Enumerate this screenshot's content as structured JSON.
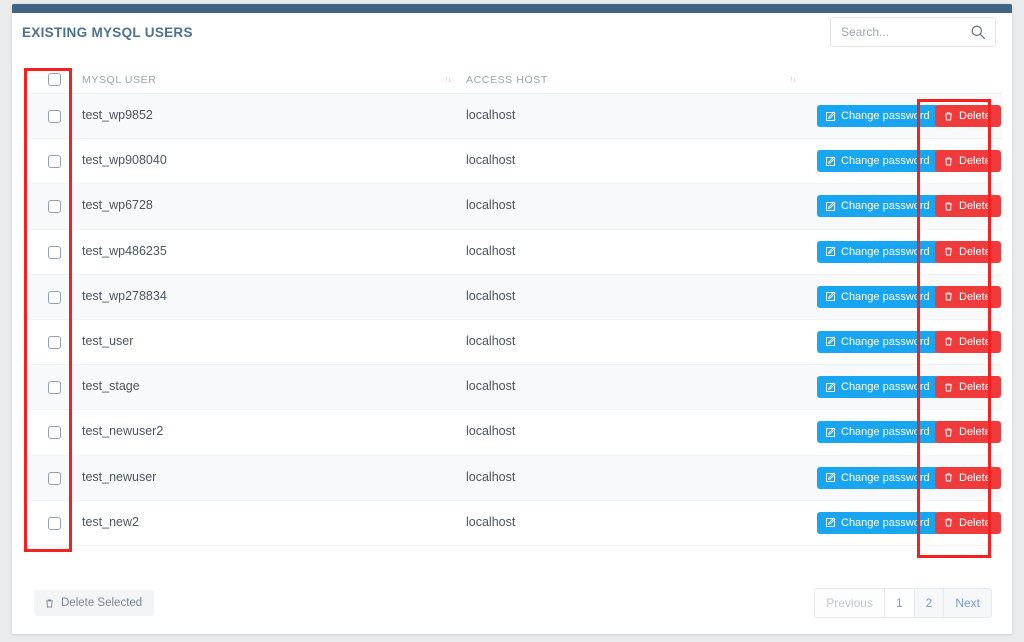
{
  "panel": {
    "title": "EXISTING MYSQL USERS",
    "accent_color": "#3f6583"
  },
  "search": {
    "placeholder": "Search...",
    "value": "",
    "icon": "search-icon"
  },
  "table": {
    "columns": [
      {
        "key": "select",
        "label": ""
      },
      {
        "key": "user",
        "label": "MYSQL USER",
        "sort_icon": "sort-updown-icon"
      },
      {
        "key": "host",
        "label": "ACCESS HOST",
        "sort_icon": "sort-updown-icon"
      },
      {
        "key": "actions",
        "label": ""
      }
    ],
    "sort_glyph": "↑↓",
    "rows": [
      {
        "user": "test_wp9852",
        "host": "localhost",
        "checked": false
      },
      {
        "user": "test_wp908040",
        "host": "localhost",
        "checked": false
      },
      {
        "user": "test_wp6728",
        "host": "localhost",
        "checked": false
      },
      {
        "user": "test_wp486235",
        "host": "localhost",
        "checked": false
      },
      {
        "user": "test_wp278834",
        "host": "localhost",
        "checked": false
      },
      {
        "user": "test_user",
        "host": "localhost",
        "checked": false
      },
      {
        "user": "test_stage",
        "host": "localhost",
        "checked": false
      },
      {
        "user": "test_newuser2",
        "host": "localhost",
        "checked": false
      },
      {
        "user": "test_newuser",
        "host": "localhost",
        "checked": false
      },
      {
        "user": "test_new2",
        "host": "localhost",
        "checked": false
      }
    ],
    "actions": {
      "change_password_label": "Change password",
      "change_password_icon": "edit-square-icon",
      "change_password_color": "#18a5f2",
      "delete_label": "Delete",
      "delete_icon": "trash-icon",
      "delete_color": "#ef3b3b"
    }
  },
  "footer": {
    "delete_selected_label": "Delete Selected",
    "delete_selected_icon": "trash-icon",
    "pagination": {
      "previous_label": "Previous",
      "next_label": "Next",
      "pages": [
        "1",
        "2"
      ],
      "current_page": "1",
      "previous_disabled": true
    }
  },
  "annotations": {
    "highlight_color": "#f91f1f",
    "boxes": [
      {
        "name": "row-checkbox-column-highlight"
      },
      {
        "name": "delete-button-column-highlight"
      }
    ]
  }
}
